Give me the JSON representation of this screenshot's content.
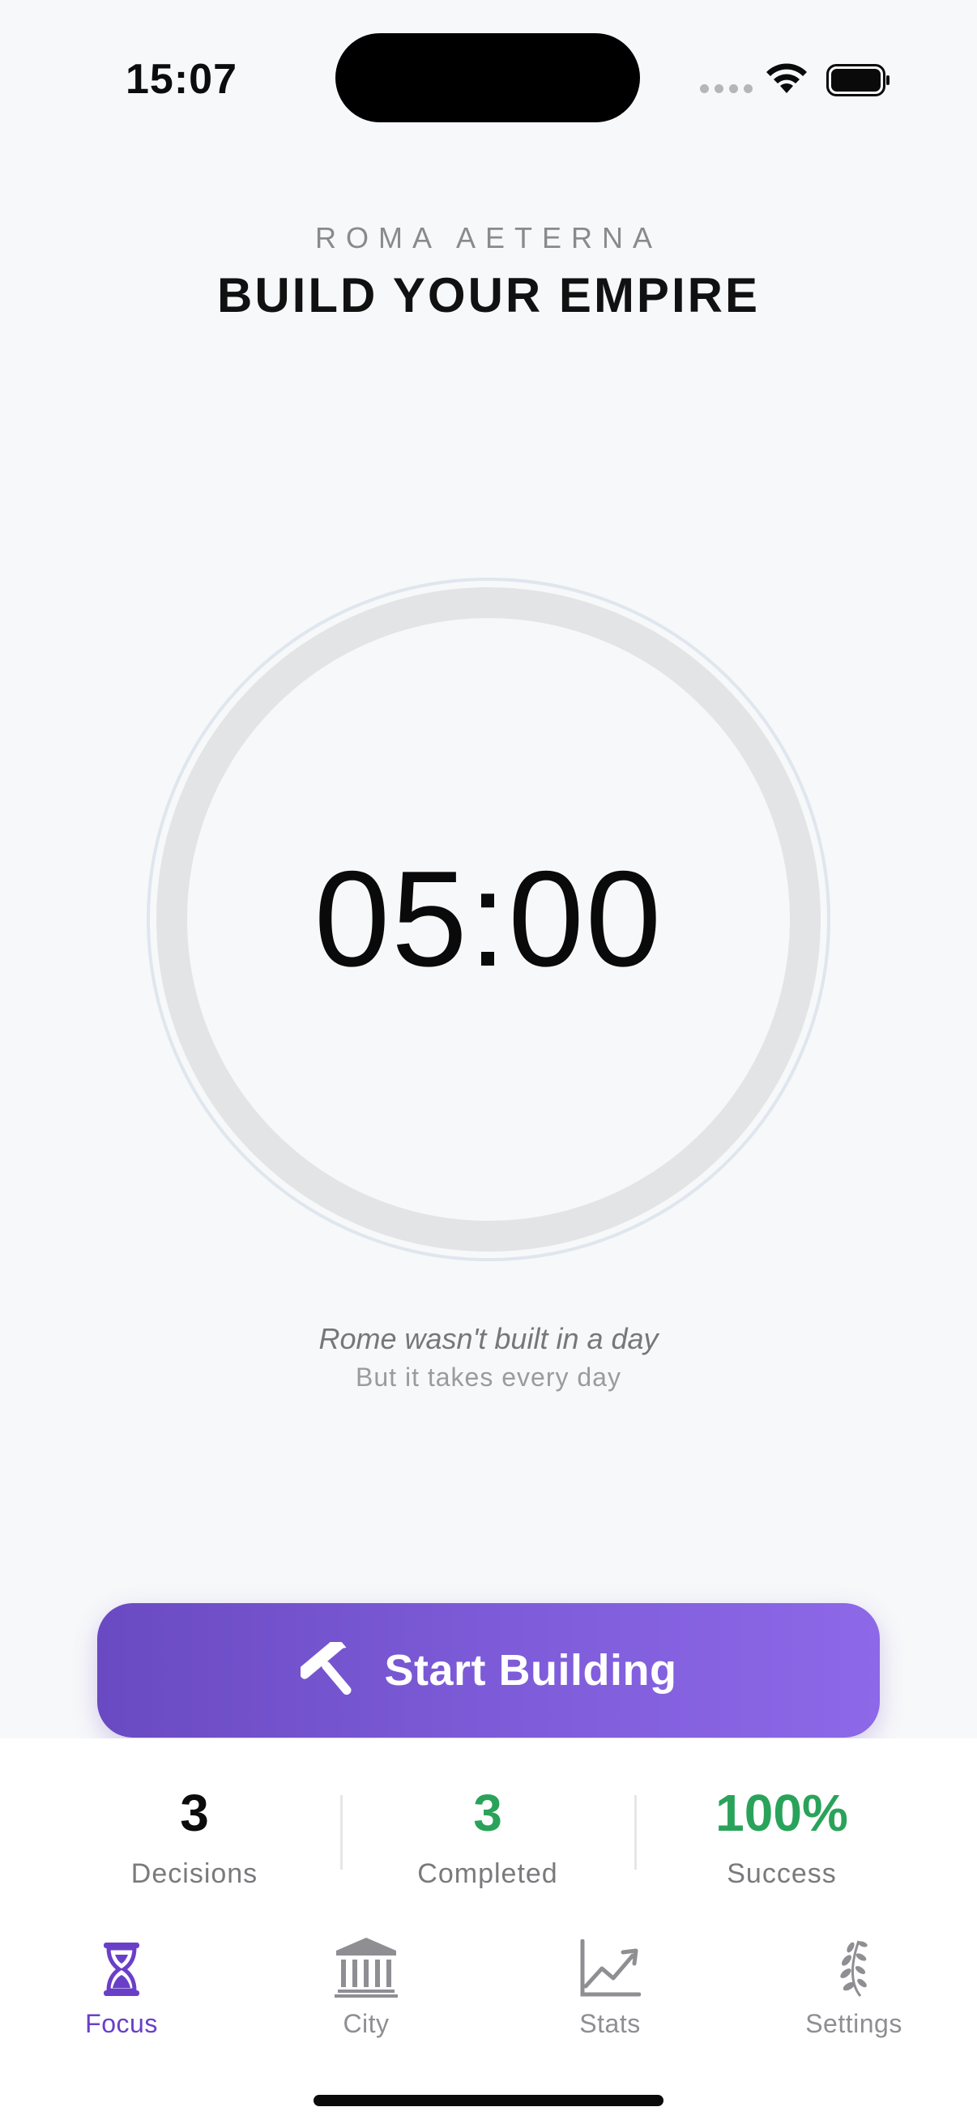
{
  "status_bar": {
    "time": "15:07"
  },
  "header": {
    "kicker": "ROMA AETERNA",
    "title": "BUILD YOUR EMPIRE"
  },
  "timer": {
    "display": "05:00",
    "progress": 0
  },
  "quote": {
    "line1": "Rome wasn't built in a day",
    "line2": "But it takes every day"
  },
  "start_button": {
    "label": "Start Building",
    "icon": "hammer-icon"
  },
  "stats": [
    {
      "value": "3",
      "label": "Decisions",
      "color": "#0c0c0c"
    },
    {
      "value": "3",
      "label": "Completed",
      "color": "#2aa35a"
    },
    {
      "value": "100%",
      "label": "Success",
      "color": "#2aa35a"
    }
  ],
  "tabs": [
    {
      "label": "Focus",
      "icon": "hourglass-icon",
      "active": true
    },
    {
      "label": "City",
      "icon": "temple-icon",
      "active": false
    },
    {
      "label": "Stats",
      "icon": "chart-icon",
      "active": false
    },
    {
      "label": "Settings",
      "icon": "laurel-icon",
      "active": false
    }
  ],
  "colors": {
    "accent": "#6a3fc8",
    "success": "#2aa35a",
    "background": "#f7f8fa"
  }
}
